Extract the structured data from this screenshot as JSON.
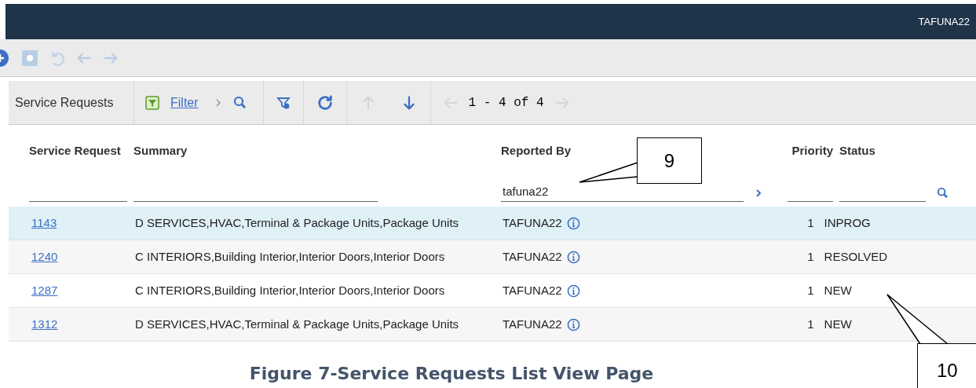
{
  "header": {
    "user": "TAFUNA22"
  },
  "list_toolbar": {
    "title": "Service Requests",
    "filter_link": "Filter",
    "pagination": "1 - 4 of 4"
  },
  "columns": [
    {
      "label": "Service Request"
    },
    {
      "label": "Summary"
    },
    {
      "label": "Reported By",
      "filter": "tafuna22"
    },
    {
      "label": "Priority"
    },
    {
      "label": "Status"
    }
  ],
  "rows": [
    {
      "id": "1143",
      "summary": "D SERVICES,HVAC,Terminal & Package Units,Package Units",
      "reported_by": "TAFUNA22",
      "priority": "1",
      "status": "INPROG",
      "selected": true
    },
    {
      "id": "1240",
      "summary": "C INTERIORS,Building Interior,Interior Doors,Interior Doors",
      "reported_by": "TAFUNA22",
      "priority": "1",
      "status": "RESOLVED",
      "selected": false
    },
    {
      "id": "1287",
      "summary": "C INTERIORS,Building Interior,Interior Doors,Interior Doors",
      "reported_by": "TAFUNA22",
      "priority": "1",
      "status": "NEW",
      "selected": false
    },
    {
      "id": "1312",
      "summary": "D SERVICES,HVAC,Terminal & Package Units,Package Units",
      "reported_by": "TAFUNA22",
      "priority": "1",
      "status": "NEW",
      "selected": false
    }
  ],
  "callouts": [
    "9",
    "10"
  ],
  "caption": "Figure 7-Service Requests List View Page"
}
